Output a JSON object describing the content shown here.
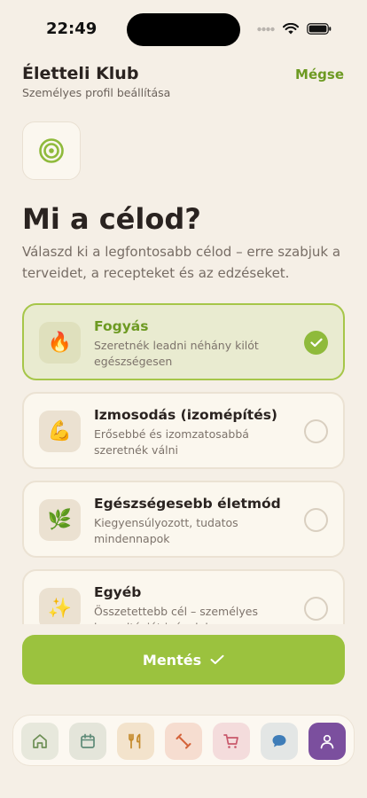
{
  "status_bar": {
    "time": "22:49"
  },
  "header": {
    "title": "Életteli Klub",
    "subtitle": "Személyes profil beállítása",
    "cancel_label": "Mégse"
  },
  "page": {
    "goal_icon": "target-icon",
    "heading": "Mi a célod?",
    "description": "Válaszd ki a legfontosabb célod – erre szabjuk a terveidet, a recepteket és az edzéseket."
  },
  "options": [
    {
      "emoji": "🔥",
      "icon": "fire-icon",
      "title": "Fogyás",
      "description": "Szeretnék leadni néhány kilót egészségesen",
      "selected": true
    },
    {
      "emoji": "💪",
      "icon": "flexed-biceps-icon",
      "title": "Izmosodás (izomépítés)",
      "description": "Erősebbé és izomzatosabbá szeretnék válni",
      "selected": false
    },
    {
      "emoji": "🌿",
      "icon": "herb-icon",
      "title": "Egészségesebb életmód",
      "description": "Kiegyensúlyozott, tudatos mindennapok",
      "selected": false
    },
    {
      "emoji": "✨",
      "icon": "sparkles-icon",
      "title": "Egyéb",
      "description": "Összetettebb cél – személyes konzultációt igénylek",
      "selected": false
    }
  ],
  "save_button": {
    "label": "Mentés"
  },
  "bottom_nav": [
    {
      "icon": "home-icon",
      "active": false
    },
    {
      "icon": "calendar-icon",
      "active": false
    },
    {
      "icon": "fork-knife-icon",
      "active": false
    },
    {
      "icon": "dumbbell-icon",
      "active": false
    },
    {
      "icon": "cart-icon",
      "active": false
    },
    {
      "icon": "chat-icon",
      "active": false
    },
    {
      "icon": "profile-icon",
      "active": true
    }
  ],
  "colors": {
    "background": "#f5efe6",
    "accent_green": "#9bc23e",
    "accent_green_text": "#6d9a22",
    "active_nav": "#7b4f9e"
  }
}
